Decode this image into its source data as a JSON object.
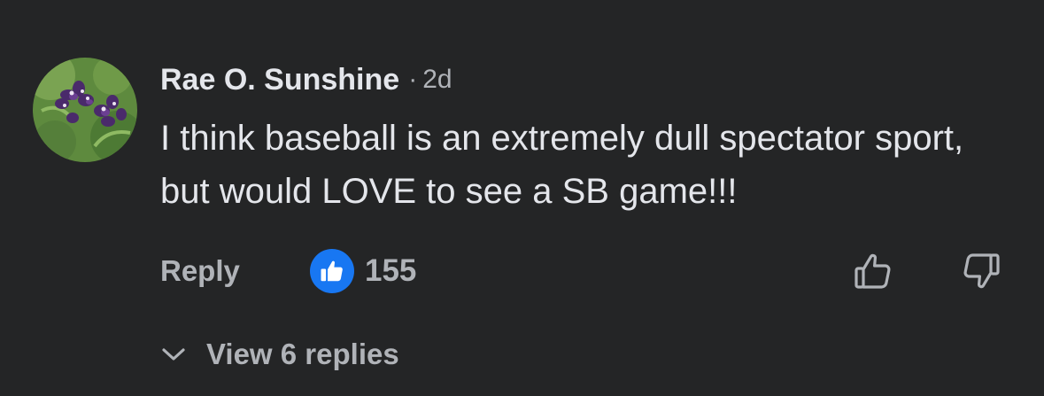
{
  "comment": {
    "author": "Rae O. Sunshine",
    "separator": "·",
    "time": "2d",
    "text": "I think baseball is an extremely dull spectator sport, but would LOVE to see a SB game!!!"
  },
  "actions": {
    "reply_label": "Reply",
    "like_count": "155",
    "like_icon": "thumbs-up-icon",
    "upvote_icon": "thumbs-up-outline-icon",
    "downvote_icon": "thumbs-down-outline-icon"
  },
  "replies": {
    "label": "View 6 replies",
    "icon": "chevron-down-icon"
  },
  "colors": {
    "background": "#242526",
    "text_primary": "#e4e6eb",
    "text_secondary": "#b0b3b8",
    "like_blue": "#1877f2"
  }
}
